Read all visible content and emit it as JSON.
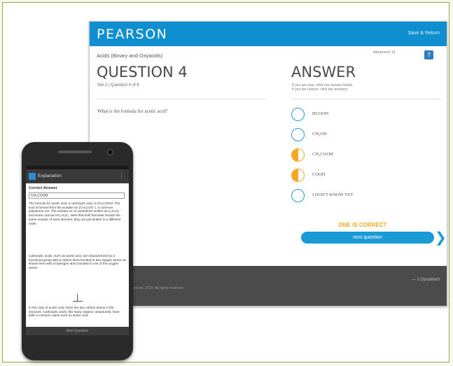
{
  "monitor": {
    "header": {
      "brand": "PEARSON",
      "save_return": "Save & Return"
    },
    "breadcrumb": "Acids (Binary and Oxyacids)",
    "user_label": "tstudymum 10",
    "help_icon": "?",
    "question": {
      "title": "QUESTION 4",
      "subtitle": "Set 2 | Question 4 of 8",
      "text": "What is the formula for acetic acid?"
    },
    "answer": {
      "title": "ANSWER",
      "help_line1": "If you are sure, click one answer below.",
      "help_line2": "If you are unsure, click two answers.",
      "options": [
        {
          "label": "HCOOH",
          "state": "empty"
        },
        {
          "label": "CH₃OH",
          "state": "empty"
        },
        {
          "label": "CH₃COOH",
          "state": "half"
        },
        {
          "label": "COOH",
          "state": "half"
        },
        {
          "label": "I DON'T KNOW YET",
          "state": "empty"
        }
      ],
      "result": "ONE IS CORRECT",
      "next_button": "next question"
    },
    "footer": {
      "copyright": "Pearson Inc. 2014. All rights reserved.",
      "logo": "— ≡ DynaMath"
    }
  },
  "phone": {
    "app_title": "Explanation",
    "menu_icon": "⋮",
    "correct_answer_label": "Correct Answer",
    "correct_answer_value": "CH₃COOH",
    "paragraph1": "The formula for acetic acid, a carboxylic acid, is CH₃COOH. The acid is formed from the acetate ion (CH₃COO⁻), a common polyatomic ion. The acetate ion is sometimes written as C₂H₃O₂⁻ and acetic acid as HC₂H₃O₂. Note that both formulas include the same number of each element; they are just written in a different order.",
    "paragraph2": "Carboxylic acids, such as acetic acid, are characterized by a functional group with a carbon atom bonded to two oxygen atoms as shown here with a hydrogen atom bonded to one of the oxygen atoms.",
    "paragraph3": "In the case of acetic acid, there are two carbon atoms in the structure. Carboxylic acids, like many organic compounds, have both a common name such as acetic acid",
    "next_button": "Next Question"
  },
  "colors": {
    "brand_blue": "#0f8fd0",
    "accent_orange": "#f5a623",
    "footer_gray": "#4b4b4b",
    "frame_green": "#8fae3d"
  }
}
